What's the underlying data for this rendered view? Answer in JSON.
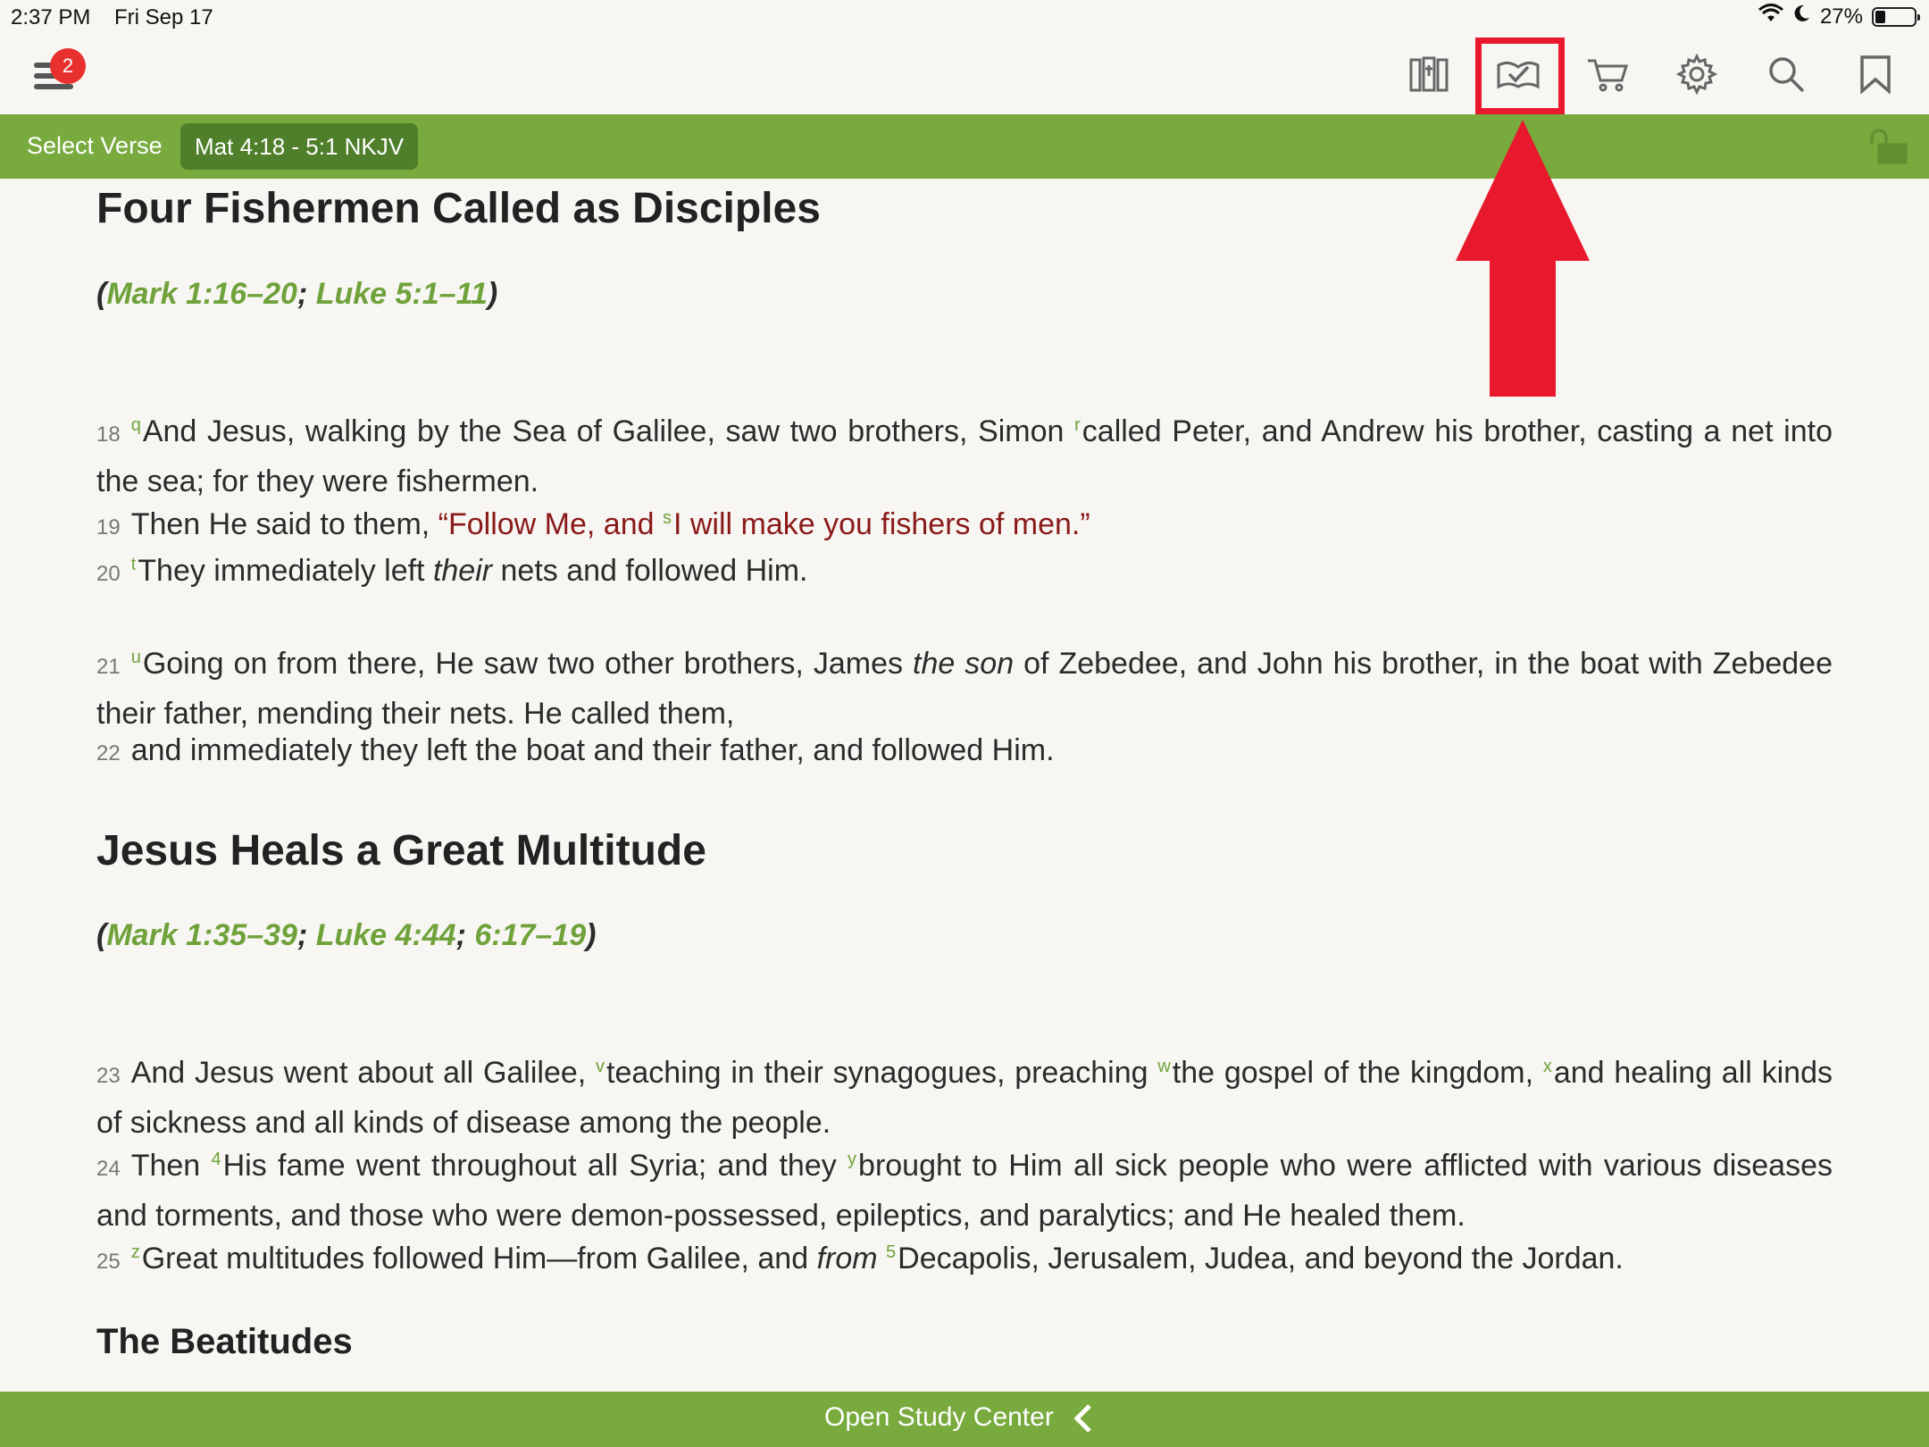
{
  "status": {
    "time": "2:37 PM",
    "date": "Fri Sep 17",
    "battery_pct": "27%",
    "battery_level": 0.27
  },
  "toolbar": {
    "menu_badge": "2",
    "icons": [
      "library-icon",
      "reading-plan-icon",
      "cart-icon",
      "gear-icon",
      "search-icon",
      "bookmark-icon"
    ],
    "highlighted_icon": "reading-plan-icon"
  },
  "verse_bar": {
    "select_label": "Select Verse",
    "reference": "Mat 4:18 - 5:1 NKJV"
  },
  "sections": {
    "s1": {
      "title": "Four Fishermen Called as Disciples",
      "xref_open": "(",
      "xref_1": "Mark 1:16–20",
      "xref_sep": "; ",
      "xref_2": "Luke 5:1–11",
      "xref_close": ")"
    },
    "s2": {
      "title": "Jesus Heals a Great Multitude",
      "xref_open": "(",
      "xref_1": "Mark 1:35–39",
      "xref_sep1": "; ",
      "xref_2": "Luke 4:44",
      "xref_sep2": "; ",
      "xref_3": "6:17–19",
      "xref_close": ")"
    },
    "s3": {
      "title": "The Beatitudes"
    }
  },
  "verses": {
    "v18": {
      "num": "18",
      "fn1": "q",
      "t1": "And Jesus, walking by the Sea of Galilee, saw two brothers, Simon ",
      "fn2": "r",
      "t2": "called Peter, and Andrew his brother, casting a net into the sea; for they were fishermen."
    },
    "v19": {
      "num": "19",
      "t1": "Then He said to them, ",
      "red1": "“Follow Me, and ",
      "fn1": "s",
      "red2": "I will make you fishers of men.”"
    },
    "v20": {
      "num": "20",
      "fn1": "t",
      "t1": "They immediately left ",
      "it1": "their",
      "t2": " nets and followed Him."
    },
    "v21": {
      "num": "21",
      "fn1": "u",
      "t1": "Going on from there, He saw two other brothers, James ",
      "it1": "the son",
      "t2": " of Zebedee, and John his brother, in the boat with Zebedee their father, mending their nets. He called them,"
    },
    "v22": {
      "num": "22",
      "t1": "and immediately they left the boat and their father, and followed Him."
    },
    "v23": {
      "num": "23",
      "t1": "And Jesus went about all Galilee, ",
      "fn1": "v",
      "t2": "teaching in their synagogues, preaching ",
      "fn2": "w",
      "t3": "the gospel of the kingdom, ",
      "fn3": "x",
      "t4": "and healing all kinds of sickness and all kinds of disease among the people."
    },
    "v24": {
      "num": "24",
      "t1": "Then ",
      "fn1": "4",
      "t2": "His fame went throughout all Syria; and they ",
      "fn2": "y",
      "t3": "brought to Him all sick people who were afflicted with various dis­eases and torments, and those who were demon-possessed, epileptics, and paralytics; and He healed them."
    },
    "v25": {
      "num": "25",
      "fn1": "z",
      "t1": "Great multitudes followed Him—from Galilee, and ",
      "it1": "from",
      "t2": " ",
      "fn2": "5",
      "t3": "Decapolis, Jerusalem, Judea, and beyond the Jordan."
    }
  },
  "bottom": {
    "label": "Open Study Center"
  },
  "colors": {
    "accent_green": "#79aa3e",
    "dark_green": "#4f7f2a",
    "link_green": "#6fa23a",
    "words_of_christ": "#8a1a1a",
    "annotation_red": "#e8192c"
  }
}
